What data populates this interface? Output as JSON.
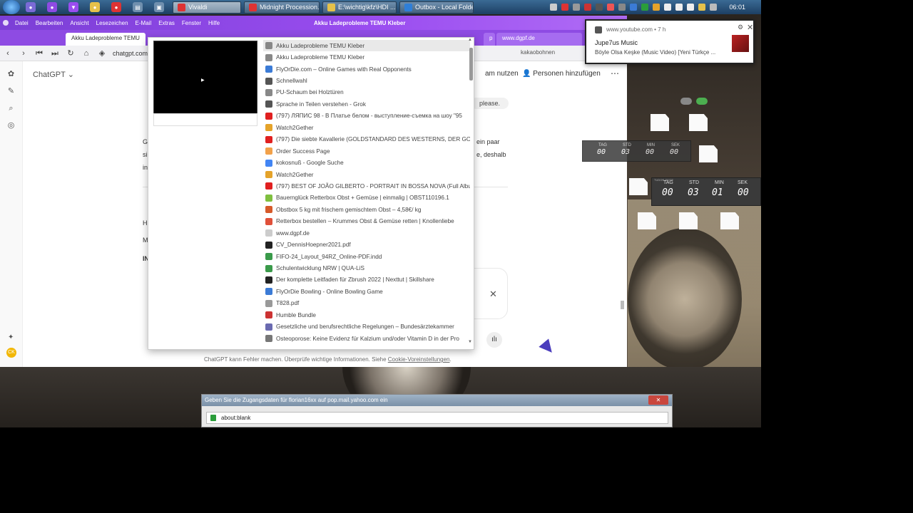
{
  "taskbar": {
    "buttons": [
      {
        "label": "Vivaldi",
        "color": "#d33"
      },
      {
        "label": "Midnight Procession...",
        "color": "#d33"
      },
      {
        "label": "E:\\wichtig\\kfz\\HDI ...",
        "color": "#e5c14a"
      },
      {
        "label": "Outbox - Local Folde...",
        "color": "#2f7fd8"
      }
    ],
    "clock": "06:01"
  },
  "browser": {
    "window_title": "Akku Ladeprobleme TEMU Kleber",
    "menu": [
      "Datei",
      "Bearbeiten",
      "Ansicht",
      "Lesezeichen",
      "E-Mail",
      "Extras",
      "Fenster",
      "Hilfe"
    ],
    "tabs": [
      "Akku Ladeprobleme TEMU",
      "p",
      "www.dgpf.de"
    ],
    "url": "chatgpt.com/c",
    "search_text": "kakaobohnen"
  },
  "chatgpt": {
    "app_title": "ChatGPT",
    "header_partial": "am nutzen",
    "people_button": "Personen hinzufügen",
    "chip_text": "please.",
    "body_left": [
      "G",
      "si",
      "in"
    ],
    "body_right": [
      "ein paar",
      "e, deshalb"
    ],
    "side_letters": [
      "H",
      "M",
      "IN"
    ],
    "footer_note": "ChatGPT kann Fehler machen. Überprüfe wichtige Informationen. Siehe ",
    "footer_link": "Cookie-Voreinstellungen",
    "footer_end": "."
  },
  "history": {
    "items": [
      {
        "title": "Akku Ladeprobleme TEMU Kleber",
        "color": "#888"
      },
      {
        "title": "Akku Ladeprobleme TEMU Kleber",
        "color": "#888"
      },
      {
        "title": "FlyOrDie.com – Online Games with Real Opponents",
        "color": "#3b7bd6"
      },
      {
        "title": "Schnellwahl",
        "color": "#555"
      },
      {
        "title": "PU-Schaum bei Holztüren",
        "color": "#888"
      },
      {
        "title": "Sprache in Teilen verstehen - Grok",
        "color": "#555"
      },
      {
        "title": "(797) ЛЯПИС 98 - В Платье белом - выступление-съемка на шоу \"95",
        "color": "#e02020"
      },
      {
        "title": "Watch2Gether",
        "color": "#e5a32a"
      },
      {
        "title": "(797) Die siebte Kavallerie (GOLDSTANDARD DES WESTERNS, DER GOL",
        "color": "#e02020"
      },
      {
        "title": "Order Success Page",
        "color": "#f2a14a"
      },
      {
        "title": "kokosnuß - Google Suche",
        "color": "#4285f4"
      },
      {
        "title": "Watch2Gether",
        "color": "#e5a32a"
      },
      {
        "title": "(797) BEST OF JOÃO GILBERTO - PORTRAIT IN BOSSA NOVA (Full Albu",
        "color": "#e02020"
      },
      {
        "title": "Bauernglück Retterbox Obst + Gemüse | einmalig | OBST110196.1",
        "color": "#7fbf3f"
      },
      {
        "title": "Obstbox 5 kg mit frischem gemischtem Obst – 4,58€/ kg",
        "color": "#d65a2a"
      },
      {
        "title": "Retterbox bestellen – Krummes Obst & Gemüse retten | Knollenliebe",
        "color": "#e0503a"
      },
      {
        "title": "www.dgpf.de",
        "color": "#cccccc"
      },
      {
        "title": "CV_DennisHoepner2021.pdf",
        "color": "#222"
      },
      {
        "title": "FIFO-24_Layout_94RZ_Online-PDF.indd",
        "color": "#3a9a4a"
      },
      {
        "title": "Schulentwicklung NRW | QUA-LiS",
        "color": "#3a9a4a"
      },
      {
        "title": "Der komplette Leitfaden für Zbrush 2022 | Nexttut | Skillshare",
        "color": "#222"
      },
      {
        "title": "FlyOrDie Bowling - Online Bowling Game",
        "color": "#3b7bd6"
      },
      {
        "title": "T828.pdf",
        "color": "#999"
      },
      {
        "title": "Humble Bundle",
        "color": "#cc3333"
      },
      {
        "title": "Gesetzliche und berufsrechtliche Regelungen – Bundesärztekammer",
        "color": "#6a6ab0"
      },
      {
        "title": "Osteoporose: Keine Evidenz für Kalzium und/oder Vitamin D in der Pro",
        "color": "#777"
      }
    ]
  },
  "notification": {
    "source": "www.youtube.com • 7 h",
    "title": "Jupe7us Music",
    "body": "Böyle Olsa Keşke (Music Video) [Yeni Türkçe ..."
  },
  "countdown_small": {
    "labels": [
      "TAG",
      "STD",
      "MIN",
      "SEK"
    ],
    "values": [
      "00",
      "03",
      "00",
      "00"
    ]
  },
  "countdown_large": {
    "title": "TUDOR-SEITE",
    "labels": [
      "TAG",
      "STD",
      "MIN",
      "SEK"
    ],
    "values": [
      "00",
      "03",
      "01",
      "00"
    ]
  },
  "login_dialog": {
    "title": "Geben Sie die Zugangsdaten für florian16xx auf pop.mail.yahoo.com ein",
    "url": "about:blank"
  }
}
